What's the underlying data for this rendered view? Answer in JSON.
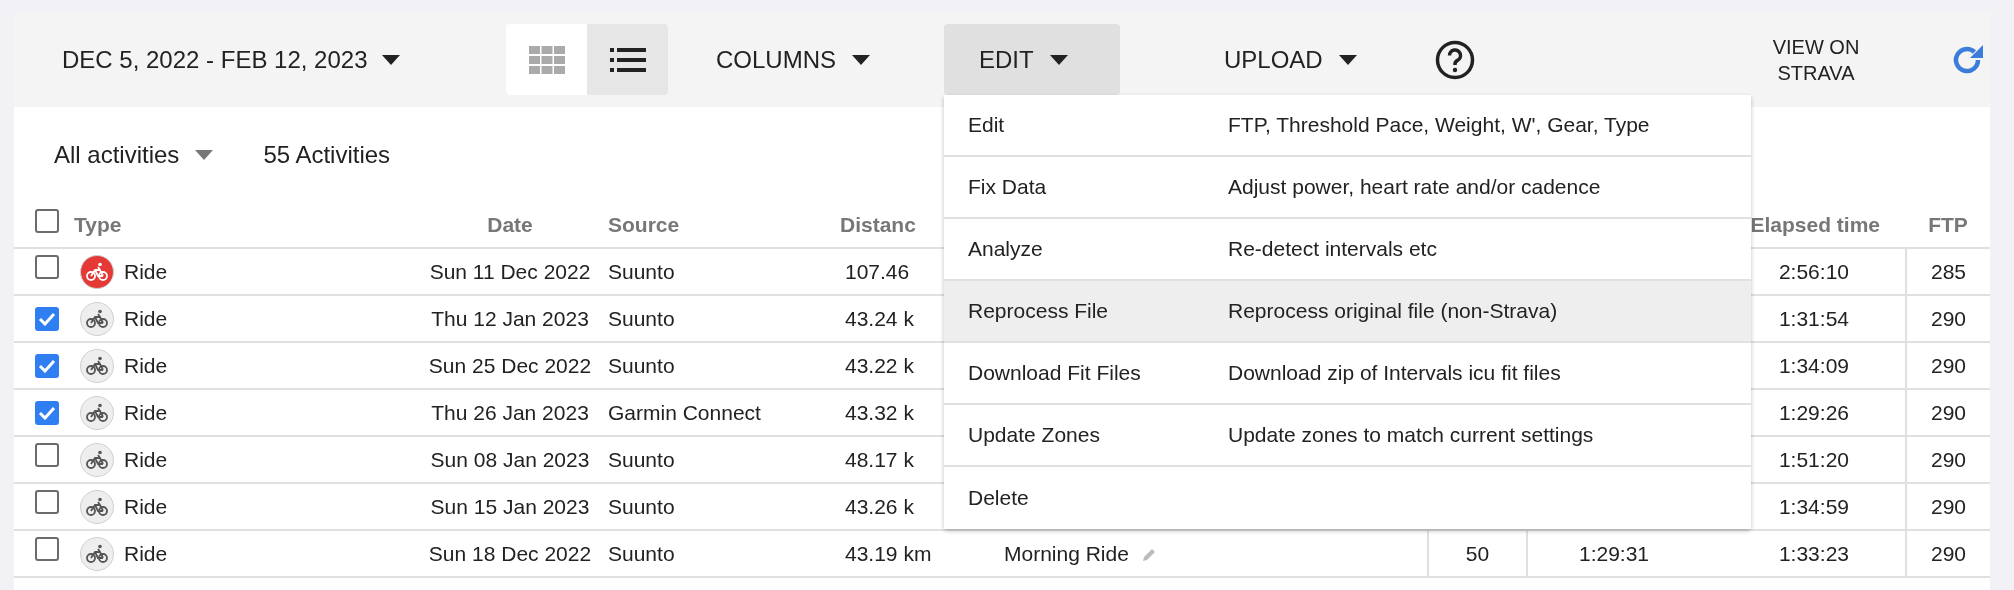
{
  "toolbar": {
    "date_range": "DEC 5, 2022 - FEB 12, 2023",
    "view_toggle": [
      {
        "kind": "grid",
        "selected": false
      },
      {
        "kind": "list",
        "selected": true
      }
    ],
    "menus": [
      {
        "label": "COLUMNS",
        "open": false
      },
      {
        "label": "EDIT",
        "open": true
      },
      {
        "label": "UPLOAD",
        "open": false
      }
    ],
    "view_on_strava": "VIEW ON STRAVA"
  },
  "filter": {
    "label": "All activities",
    "count": "55 Activities"
  },
  "table": {
    "all_checked": false,
    "columns": {
      "type": "Type",
      "date": "Date",
      "source": "Source",
      "distance": "Distanc",
      "elapsed_time": "Elapsed time",
      "ftp": "FTP"
    },
    "rows": [
      {
        "checked": false,
        "type": "Ride",
        "highlighted": true,
        "date": "Sun 11 Dec 2022",
        "source": "Suunto",
        "distance": "107.46",
        "elapsed_time": "2:56:10",
        "ftp": "285"
      },
      {
        "checked": true,
        "type": "Ride",
        "highlighted": false,
        "date": "Thu 12 Jan 2023",
        "source": "Suunto",
        "distance": "43.24 k",
        "elapsed_time": "1:31:54",
        "ftp": "290"
      },
      {
        "checked": true,
        "type": "Ride",
        "highlighted": false,
        "date": "Sun 25 Dec 2022",
        "source": "Suunto",
        "distance": "43.22 k",
        "elapsed_time": "1:34:09",
        "ftp": "290"
      },
      {
        "checked": true,
        "type": "Ride",
        "highlighted": false,
        "date": "Thu 26 Jan 2023",
        "source": "Garmin Connect",
        "distance": "43.32 k",
        "elapsed_time": "1:29:26",
        "ftp": "290"
      },
      {
        "checked": false,
        "type": "Ride",
        "highlighted": false,
        "date": "Sun 08 Jan 2023",
        "source": "Suunto",
        "distance": "48.17 k",
        "elapsed_time": "1:51:20",
        "ftp": "290"
      },
      {
        "checked": false,
        "type": "Ride",
        "highlighted": false,
        "date": "Sun 15 Jan 2023",
        "source": "Suunto",
        "distance": "43.26 k",
        "elapsed_time": "1:34:59",
        "ftp": "290"
      },
      {
        "checked": false,
        "type": "Ride",
        "highlighted": false,
        "date": "Sun 18 Dec 2022",
        "source": "Suunto",
        "distance": "43.19 km",
        "name": "Morning Ride",
        "column_6": "50",
        "column_7": "1:29:31",
        "elapsed_time": "1:33:23",
        "ftp": "290"
      }
    ]
  },
  "edit_menu": {
    "items": [
      {
        "label": "Edit",
        "description": "FTP, Threshold Pace, Weight, W', Gear, Type",
        "selected": false
      },
      {
        "label": "Fix Data",
        "description": "Adjust power, heart rate and/or cadence",
        "selected": false
      },
      {
        "label": "Analyze",
        "description": "Re-detect intervals etc",
        "selected": false
      },
      {
        "label": "Reprocess File",
        "description": "Reprocess original file (non-Strava)",
        "selected": true
      },
      {
        "label": "Download Fit Files",
        "description": "Download zip of Intervals icu fit files",
        "selected": false
      },
      {
        "label": "Update Zones",
        "description": "Update zones to match current settings",
        "selected": false
      },
      {
        "label": "Delete",
        "selected": false
      }
    ]
  }
}
